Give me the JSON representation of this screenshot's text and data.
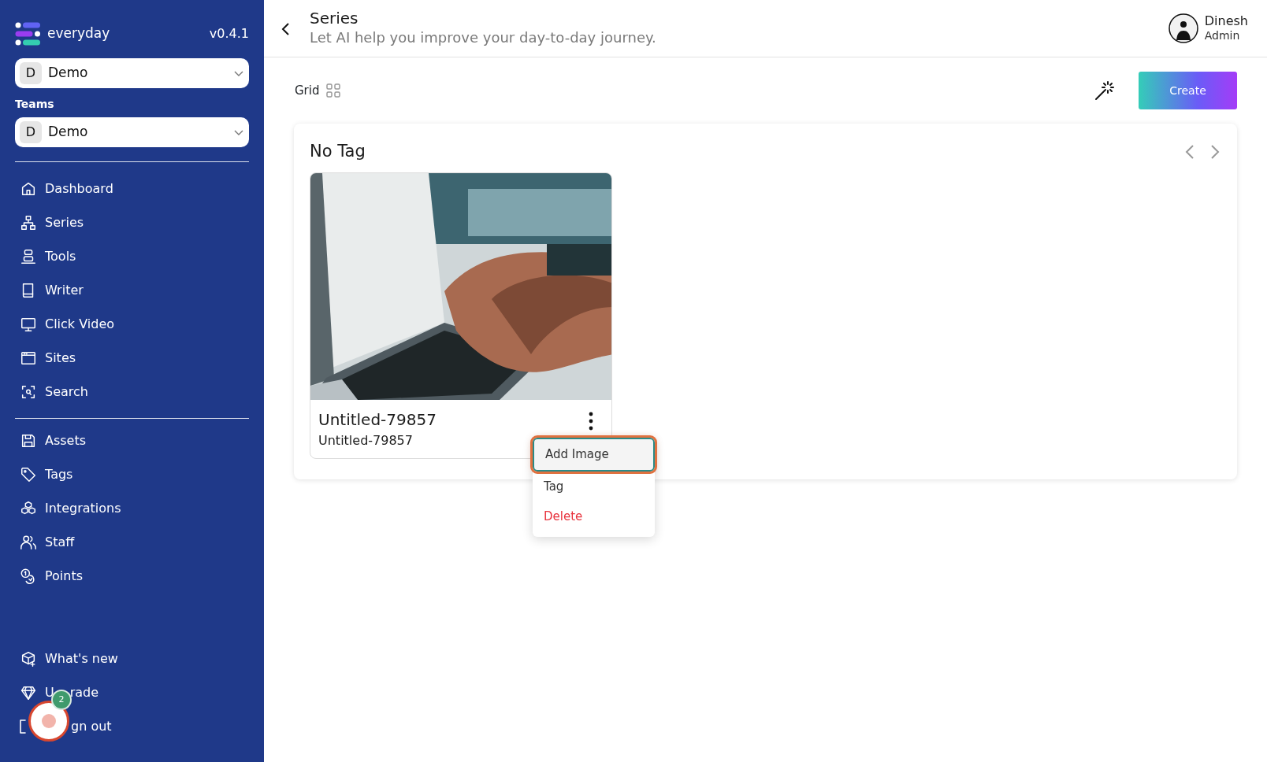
{
  "brand": {
    "name": "everyday",
    "version": "v0.4.1"
  },
  "workspace": {
    "initial": "D",
    "name": "Demo"
  },
  "teams": {
    "label": "Teams",
    "initial": "D",
    "name": "Demo"
  },
  "nav_main": [
    {
      "label": "Dashboard"
    },
    {
      "label": "Series"
    },
    {
      "label": "Tools"
    },
    {
      "label": "Writer"
    },
    {
      "label": "Click Video"
    },
    {
      "label": "Sites"
    },
    {
      "label": "Search"
    }
  ],
  "nav_secondary": [
    {
      "label": "Assets"
    },
    {
      "label": "Tags"
    },
    {
      "label": "Integrations"
    },
    {
      "label": "Staff"
    },
    {
      "label": "Points"
    }
  ],
  "nav_bottom": [
    {
      "label_parts": [
        "What's new"
      ]
    },
    {
      "label_parts": [
        "U",
        "rade"
      ]
    },
    {
      "label_parts": [
        "gn out"
      ]
    }
  ],
  "floating_badge": {
    "count": "2"
  },
  "header": {
    "title": "Series",
    "subtitle": "Let AI help you improve your day-to-day journey."
  },
  "user": {
    "name": "Dinesh",
    "role": "Admin"
  },
  "toolbar": {
    "view": "Grid",
    "create": "Create"
  },
  "group": {
    "title": "No Tag",
    "items": [
      {
        "kind": "picture",
        "title": "Untitled-79857",
        "subtitle": "Untitled-79857"
      }
    ]
  },
  "context_menu": [
    {
      "label": "Add Image",
      "kind": "normal",
      "selected": true
    },
    {
      "label": "Tag",
      "kind": "normal",
      "selected": false
    },
    {
      "label": "Delete",
      "kind": "danger",
      "selected": false
    }
  ]
}
